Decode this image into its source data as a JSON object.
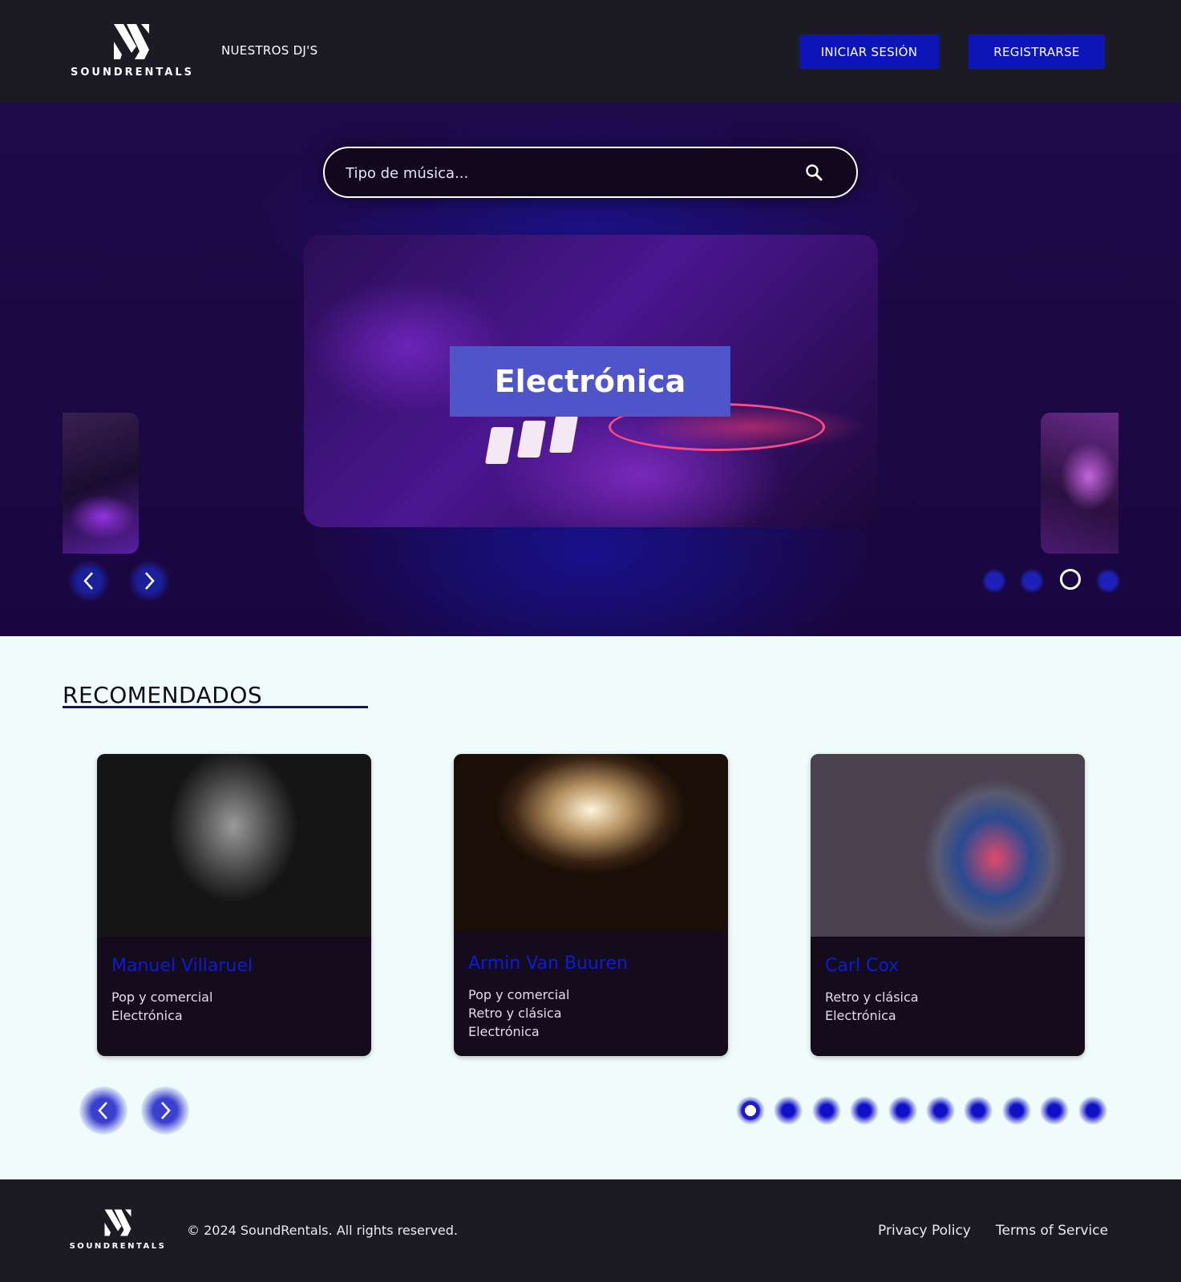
{
  "header": {
    "logo_text": "SOUNDRENTALS",
    "nav_link": "NUESTROS DJ'S",
    "login_label": "INICIAR SESIÓN",
    "register_label": "REGISTRARSE"
  },
  "hero": {
    "search_placeholder": "Tipo de música...",
    "slide_label": "Electrónica",
    "carousel_dots": 4,
    "active_dot": 3
  },
  "recommended": {
    "title": "RECOMENDADOS",
    "cards": [
      {
        "name": "Manuel Villaruel",
        "genres": [
          "Pop y comercial",
          "Electrónica"
        ]
      },
      {
        "name": "Armin Van Buuren",
        "genres": [
          "Pop y comercial",
          "Retro y clásica",
          "Electrónica"
        ]
      },
      {
        "name": "Carl Cox",
        "genres": [
          "Retro y clásica",
          "Electrónica"
        ]
      }
    ],
    "pagination_dots": 10,
    "active_dot": 1
  },
  "footer": {
    "logo_text": "SOUNDRENTALS",
    "copyright": "© 2024 SoundRentals. All rights reserved.",
    "privacy": "Privacy Policy",
    "terms": "Terms of Service"
  },
  "colors": {
    "header_bg": "#1c1a23",
    "button_blue": "#0d14b8",
    "card_name": "#0e1bd8",
    "page_bg": "#f0fcfb"
  }
}
